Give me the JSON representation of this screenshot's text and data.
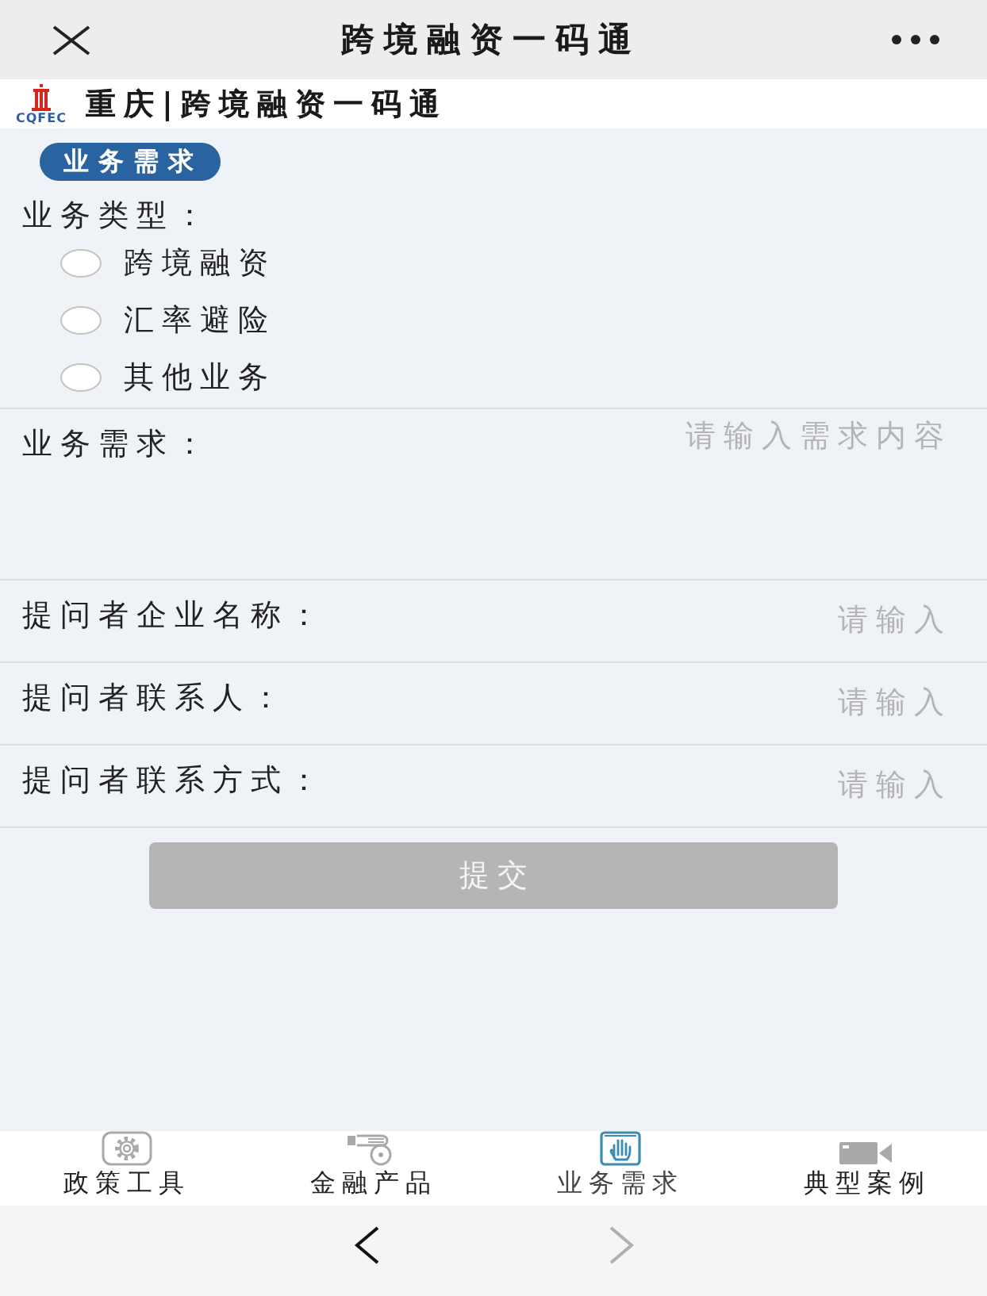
{
  "top_bar": {
    "title": "跨境融资一码通"
  },
  "header": {
    "logo_text": "CQFEC",
    "title": "重庆|跨境融资一码通"
  },
  "section_badge": "业务需求",
  "business_type": {
    "label": "业务类型：",
    "options": [
      {
        "label": "跨境融资",
        "selected": false
      },
      {
        "label": "汇率避险",
        "selected": false
      },
      {
        "label": "其他业务",
        "selected": false
      }
    ]
  },
  "fields": [
    {
      "kind": "textarea",
      "label": "业务需求：",
      "placeholder": "请输入需求内容"
    },
    {
      "kind": "input",
      "label": "提问者企业名称：",
      "placeholder": "请输入"
    },
    {
      "kind": "input",
      "label": "提问者联系人：",
      "placeholder": "请输入"
    },
    {
      "kind": "input",
      "label": "提问者联系方式：",
      "placeholder": "请输入"
    }
  ],
  "submit": {
    "label": "提交",
    "disabled": true
  },
  "tab_bar": [
    {
      "label": "政策工具",
      "selected": false
    },
    {
      "label": "金融产品",
      "selected": false
    },
    {
      "label": "业务需求",
      "selected": true
    },
    {
      "label": "典型案例",
      "selected": false
    }
  ],
  "browser_nav": {
    "back_disabled": false,
    "forward_disabled": true
  }
}
